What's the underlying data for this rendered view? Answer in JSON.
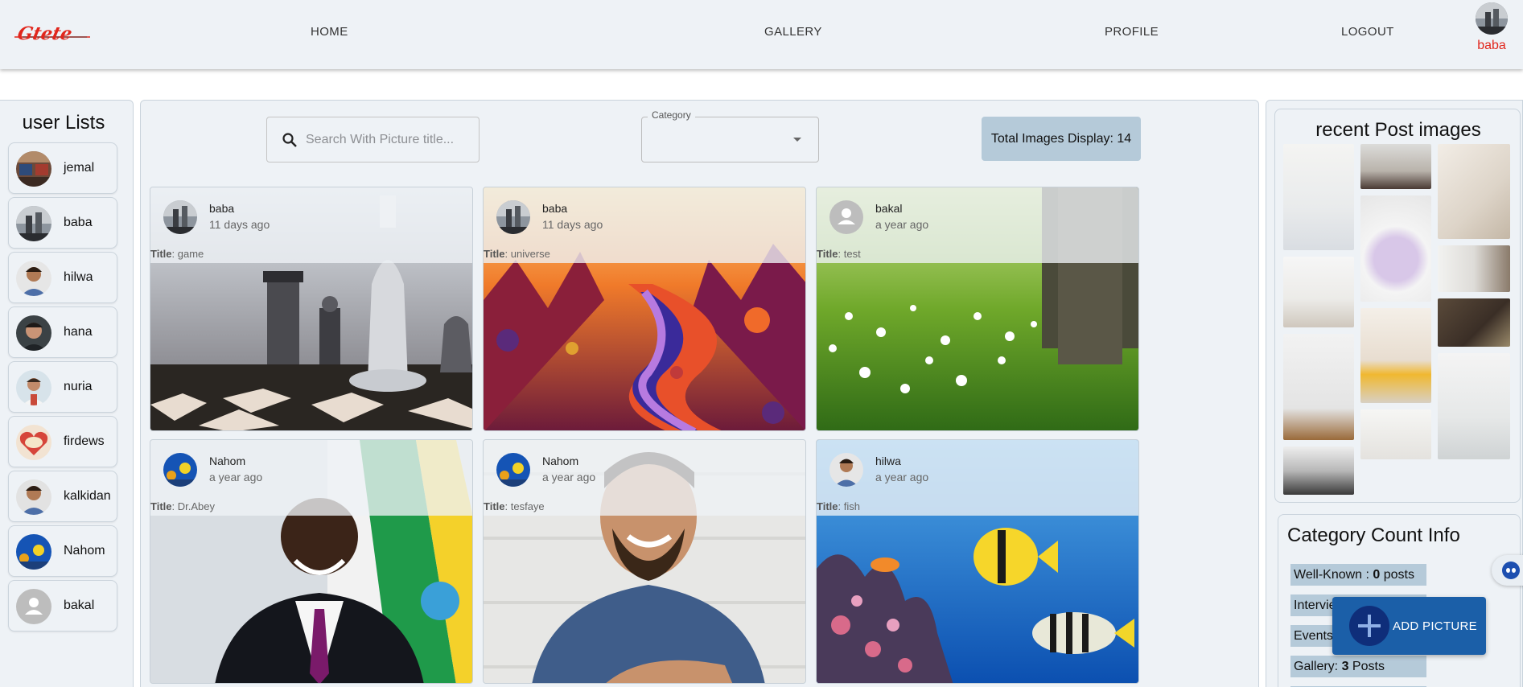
{
  "header": {
    "logo_text": "Gtere",
    "nav": [
      "HOME",
      "GALLERY",
      "PROFILE",
      "LOGOUT"
    ],
    "current_user": "baba",
    "brand_color": "#e1261c"
  },
  "users": {
    "title": "user Lists",
    "items": [
      {
        "name": "jemal",
        "avatar": "room-photo"
      },
      {
        "name": "baba",
        "avatar": "chess-photo"
      },
      {
        "name": "hilwa",
        "avatar": "man-photo"
      },
      {
        "name": "hana",
        "avatar": "man-photo"
      },
      {
        "name": "nuria",
        "avatar": "man-photo"
      },
      {
        "name": "firdews",
        "avatar": "mama-heart"
      },
      {
        "name": "kalkidan",
        "avatar": "man-photo"
      },
      {
        "name": "Nahom",
        "avatar": "fish-photo"
      },
      {
        "name": "bakal",
        "avatar": "default-person-icon"
      }
    ]
  },
  "toolbar": {
    "search_placeholder": "Search With Picture title...",
    "category_label": "Category",
    "category_value": "",
    "total_label": "Total Images Display: 14"
  },
  "posts": [
    {
      "user": "baba",
      "time": "11 days ago",
      "title_label": "Title",
      "title": "game",
      "image": "chess"
    },
    {
      "user": "baba",
      "time": "11 days ago",
      "title_label": "Title",
      "title": "universe",
      "image": "universe"
    },
    {
      "user": "bakal",
      "time": "a year ago",
      "title_label": "Title",
      "title": "test",
      "image": "meadow"
    },
    {
      "user": "Nahom",
      "time": "a year ago",
      "title_label": "Title",
      "title": "Dr.Abey",
      "image": "portrait-flag"
    },
    {
      "user": "Nahom",
      "time": "a year ago",
      "title_label": "Title",
      "title": "tesfaye",
      "image": "portrait-smile"
    },
    {
      "user": "hilwa",
      "time": "a year ago",
      "title_label": "Title",
      "title": "fish",
      "image": "fish"
    }
  ],
  "recent": {
    "title": "recent Post images"
  },
  "category_counts": {
    "title": "Category Count Info",
    "rows": [
      {
        "name": "Well-Known : ",
        "count": "0",
        "unit": " posts"
      },
      {
        "name": "Interview",
        "count": "",
        "unit": ""
      },
      {
        "name": "Events",
        "count": "",
        "unit": ""
      },
      {
        "name": "Gallery: ",
        "count": "3",
        "unit": " Posts"
      }
    ]
  },
  "fab": {
    "label": "ADD PICTURE"
  }
}
